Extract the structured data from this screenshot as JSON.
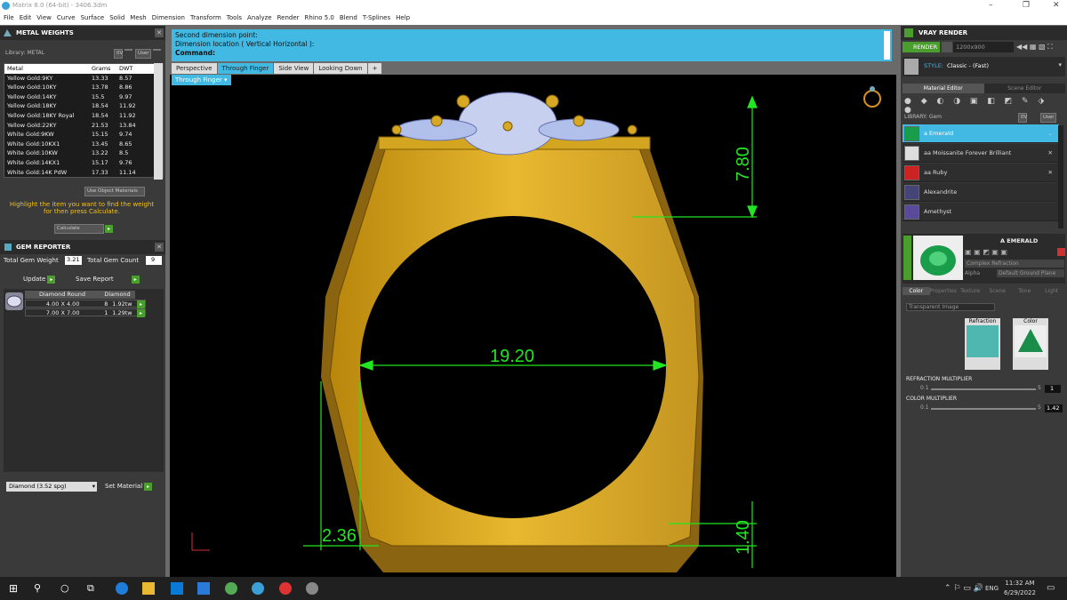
{
  "window": {
    "title": "Matrix 8.0 (64-bit) - 3406.3dm"
  },
  "menu": [
    "File",
    "Edit",
    "View",
    "Curve",
    "Surface",
    "Solid",
    "Mesh",
    "Dimension",
    "Transform",
    "Tools",
    "Analyze",
    "Render",
    "Rhino 5.0",
    "Blend",
    "T-Splines",
    "Help"
  ],
  "metal_weights": {
    "title": "METAL WEIGHTS",
    "library_label": "Library: METAL",
    "headers": [
      "Metal",
      "Grams",
      "DWT"
    ],
    "rows": [
      [
        "Yellow Gold:9KY",
        "13.33",
        "8.57"
      ],
      [
        "Yellow Gold:10KY",
        "13.78",
        "8.86"
      ],
      [
        "Yellow Gold:14KY",
        "15.5",
        "9.97"
      ],
      [
        "Yellow Gold:18KY",
        "18.54",
        "11.92"
      ],
      [
        "Yellow Gold:18KY Royal",
        "18.54",
        "11.92"
      ],
      [
        "Yellow Gold:22KY",
        "21.53",
        "13.84"
      ],
      [
        "White Gold:9KW",
        "15.15",
        "9.74"
      ],
      [
        "White Gold:10KX1",
        "13.45",
        "8.65"
      ],
      [
        "White Gold:10KW",
        "13.22",
        "8.5"
      ],
      [
        "White Gold:14KX1",
        "15.17",
        "9.76"
      ],
      [
        "White Gold:14K PdW",
        "17.33",
        "11.14"
      ]
    ],
    "use_object": "Use Object Materials",
    "hint": "Highlight the item you want to find the weight for then press Calculate.",
    "calculate": "Calculate",
    "lib_tags": [
      "0V",
      "User"
    ]
  },
  "gem_reporter": {
    "title": "GEM REPORTER",
    "total_weight_label": "Total Gem Weight",
    "total_weight": "3.21",
    "total_count_label": "Total Gem Count",
    "total_count": "9",
    "update": "Update",
    "save": "Save Report",
    "col1": "Diamond Round",
    "col2": "Diamond",
    "rows": [
      {
        "size": "4.00 X 4.00",
        "count": "8",
        "weight": "1.92tw"
      },
      {
        "size": "7.00 X 7.00",
        "count": "1",
        "weight": "1.29tw"
      }
    ],
    "material_select": "Diamond    (3.52 spg)",
    "set_material": "Set Material"
  },
  "command": {
    "line1": "Second dimension point:",
    "line2": "Dimension location ( Vertical  Horizontal ):",
    "label": "Command:"
  },
  "tabs": [
    "Perspective",
    "Through Finger",
    "Side View",
    "Looking Down"
  ],
  "viewport_label": "Through Finger",
  "dims": {
    "top": "7.80",
    "width": "19.20",
    "side": "2.36",
    "bottom": "1.40"
  },
  "vray": {
    "title": "VRAY RENDER",
    "render": "RENDER",
    "resolution": "1200x900",
    "style_label": "STYLE:",
    "style_value": "Classic - (Fast)",
    "tab_material": "Material Editor",
    "tab_scene": "Scene Editor",
    "library": "LIBRARY: Gem",
    "lib_tags": [
      "0V",
      "User"
    ],
    "gems": [
      "a Emerald",
      "aa Moissanite Forever Brilliant",
      "aa Ruby",
      "Alexandrite",
      "Amethyst"
    ],
    "selected_name": "A EMERALD",
    "material_type": "Complex Refraction",
    "alpha": "Alpha",
    "ground": "Default Ground Plane",
    "subtabs": [
      "Color",
      "Properties",
      "Texture",
      "Scene",
      "Tone",
      "Light"
    ],
    "dropdown": "Transparent Image",
    "thumb_refraction": "Refraction",
    "thumb_color": "Color",
    "refraction_mult": "REFRACTION MULTIPLIER",
    "refraction_value": "1",
    "color_mult": "COLOR MULTIPLIER",
    "color_value": "1.42",
    "min": "0.1",
    "max": "5"
  },
  "taskbar": {
    "time": "11:32 AM",
    "date": "6/29/2022",
    "lang": "ENG"
  },
  "colors": {
    "accent": "#42b9e3",
    "gold": "#e8b830",
    "dim": "#22e622"
  }
}
